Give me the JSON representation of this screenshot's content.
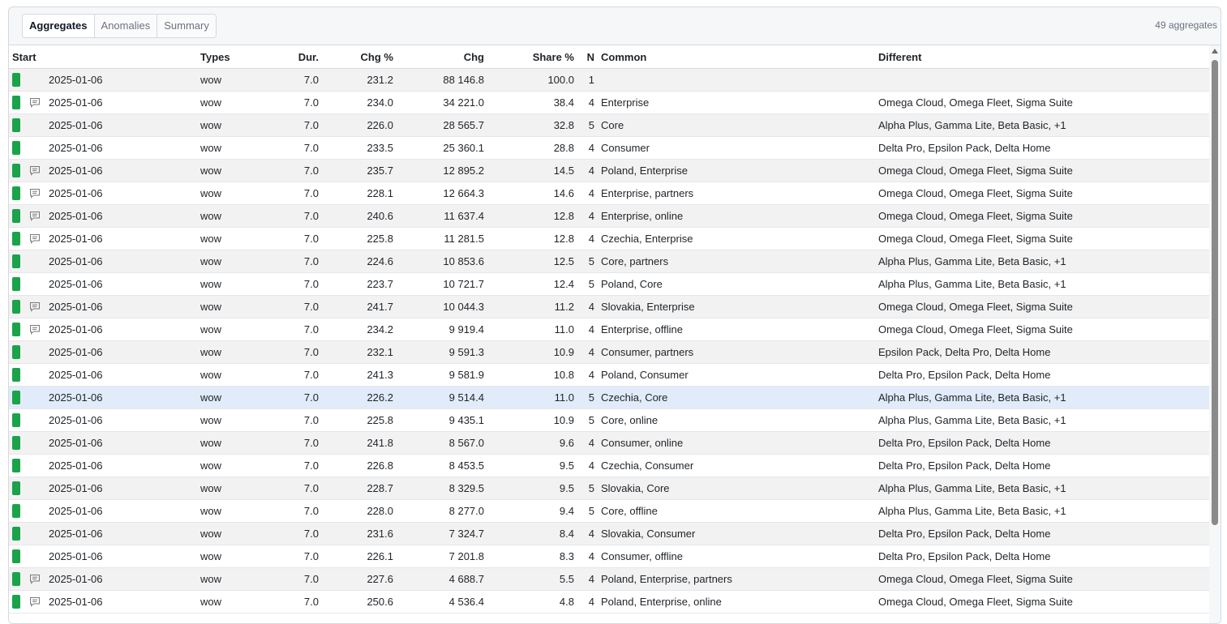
{
  "tabs": [
    {
      "label": "Aggregates",
      "active": true
    },
    {
      "label": "Anomalies",
      "active": false
    },
    {
      "label": "Summary",
      "active": false
    }
  ],
  "count_label": "49 aggregates",
  "columns": {
    "start": "Start",
    "types": "Types",
    "dur": "Dur.",
    "chg_pct": "Chg %",
    "chg": "Chg",
    "share": "Share %",
    "n": "N",
    "common": "Common",
    "different": "Different"
  },
  "colors": {
    "marker": "#1aa34a",
    "selected_row": "#e1ebf9"
  },
  "icons": {
    "comment": "comment-icon"
  },
  "rows": [
    {
      "comment": false,
      "date": "2025-01-06",
      "types": "wow",
      "dur": "7.0",
      "chg_pct": "231.2",
      "chg": "88 146.8",
      "share": "100.0",
      "n": "1",
      "common": "",
      "different": ""
    },
    {
      "comment": true,
      "date": "2025-01-06",
      "types": "wow",
      "dur": "7.0",
      "chg_pct": "234.0",
      "chg": "34 221.0",
      "share": "38.4",
      "n": "4",
      "common": "Enterprise",
      "different": "Omega Cloud, Omega Fleet, Sigma Suite"
    },
    {
      "comment": false,
      "date": "2025-01-06",
      "types": "wow",
      "dur": "7.0",
      "chg_pct": "226.0",
      "chg": "28 565.7",
      "share": "32.8",
      "n": "5",
      "common": "Core",
      "different": "Alpha Plus, Gamma Lite, Beta Basic, +1"
    },
    {
      "comment": false,
      "date": "2025-01-06",
      "types": "wow",
      "dur": "7.0",
      "chg_pct": "233.5",
      "chg": "25 360.1",
      "share": "28.8",
      "n": "4",
      "common": "Consumer",
      "different": "Delta Pro, Epsilon Pack, Delta Home"
    },
    {
      "comment": true,
      "date": "2025-01-06",
      "types": "wow",
      "dur": "7.0",
      "chg_pct": "235.7",
      "chg": "12 895.2",
      "share": "14.5",
      "n": "4",
      "common": "Poland, Enterprise",
      "different": "Omega Cloud, Omega Fleet, Sigma Suite"
    },
    {
      "comment": true,
      "date": "2025-01-06",
      "types": "wow",
      "dur": "7.0",
      "chg_pct": "228.1",
      "chg": "12 664.3",
      "share": "14.6",
      "n": "4",
      "common": "Enterprise, partners",
      "different": "Omega Cloud, Omega Fleet, Sigma Suite"
    },
    {
      "comment": true,
      "date": "2025-01-06",
      "types": "wow",
      "dur": "7.0",
      "chg_pct": "240.6",
      "chg": "11 637.4",
      "share": "12.8",
      "n": "4",
      "common": "Enterprise, online",
      "different": "Omega Cloud, Omega Fleet, Sigma Suite"
    },
    {
      "comment": true,
      "date": "2025-01-06",
      "types": "wow",
      "dur": "7.0",
      "chg_pct": "225.8",
      "chg": "11 281.5",
      "share": "12.8",
      "n": "4",
      "common": "Czechia, Enterprise",
      "different": "Omega Cloud, Omega Fleet, Sigma Suite"
    },
    {
      "comment": false,
      "date": "2025-01-06",
      "types": "wow",
      "dur": "7.0",
      "chg_pct": "224.6",
      "chg": "10 853.6",
      "share": "12.5",
      "n": "5",
      "common": "Core, partners",
      "different": "Alpha Plus, Gamma Lite, Beta Basic, +1"
    },
    {
      "comment": false,
      "date": "2025-01-06",
      "types": "wow",
      "dur": "7.0",
      "chg_pct": "223.7",
      "chg": "10 721.7",
      "share": "12.4",
      "n": "5",
      "common": "Poland, Core",
      "different": "Alpha Plus, Gamma Lite, Beta Basic, +1"
    },
    {
      "comment": true,
      "date": "2025-01-06",
      "types": "wow",
      "dur": "7.0",
      "chg_pct": "241.7",
      "chg": "10 044.3",
      "share": "11.2",
      "n": "4",
      "common": "Slovakia, Enterprise",
      "different": "Omega Cloud, Omega Fleet, Sigma Suite"
    },
    {
      "comment": true,
      "date": "2025-01-06",
      "types": "wow",
      "dur": "7.0",
      "chg_pct": "234.2",
      "chg": "9 919.4",
      "share": "11.0",
      "n": "4",
      "common": "Enterprise, offline",
      "different": "Omega Cloud, Omega Fleet, Sigma Suite"
    },
    {
      "comment": false,
      "date": "2025-01-06",
      "types": "wow",
      "dur": "7.0",
      "chg_pct": "232.1",
      "chg": "9 591.3",
      "share": "10.9",
      "n": "4",
      "common": "Consumer, partners",
      "different": "Epsilon Pack, Delta Pro, Delta Home"
    },
    {
      "comment": false,
      "date": "2025-01-06",
      "types": "wow",
      "dur": "7.0",
      "chg_pct": "241.3",
      "chg": "9 581.9",
      "share": "10.8",
      "n": "4",
      "common": "Poland, Consumer",
      "different": "Delta Pro, Epsilon Pack, Delta Home"
    },
    {
      "comment": false,
      "selected": true,
      "date": "2025-01-06",
      "types": "wow",
      "dur": "7.0",
      "chg_pct": "226.2",
      "chg": "9 514.4",
      "share": "11.0",
      "n": "5",
      "common": "Czechia, Core",
      "different": "Alpha Plus, Gamma Lite, Beta Basic, +1"
    },
    {
      "comment": false,
      "date": "2025-01-06",
      "types": "wow",
      "dur": "7.0",
      "chg_pct": "225.8",
      "chg": "9 435.1",
      "share": "10.9",
      "n": "5",
      "common": "Core, online",
      "different": "Alpha Plus, Gamma Lite, Beta Basic, +1"
    },
    {
      "comment": false,
      "date": "2025-01-06",
      "types": "wow",
      "dur": "7.0",
      "chg_pct": "241.8",
      "chg": "8 567.0",
      "share": "9.6",
      "n": "4",
      "common": "Consumer, online",
      "different": "Delta Pro, Epsilon Pack, Delta Home"
    },
    {
      "comment": false,
      "date": "2025-01-06",
      "types": "wow",
      "dur": "7.0",
      "chg_pct": "226.8",
      "chg": "8 453.5",
      "share": "9.5",
      "n": "4",
      "common": "Czechia, Consumer",
      "different": "Delta Pro, Epsilon Pack, Delta Home"
    },
    {
      "comment": false,
      "date": "2025-01-06",
      "types": "wow",
      "dur": "7.0",
      "chg_pct": "228.7",
      "chg": "8 329.5",
      "share": "9.5",
      "n": "5",
      "common": "Slovakia, Core",
      "different": "Alpha Plus, Gamma Lite, Beta Basic, +1"
    },
    {
      "comment": false,
      "date": "2025-01-06",
      "types": "wow",
      "dur": "7.0",
      "chg_pct": "228.0",
      "chg": "8 277.0",
      "share": "9.4",
      "n": "5",
      "common": "Core, offline",
      "different": "Alpha Plus, Gamma Lite, Beta Basic, +1"
    },
    {
      "comment": false,
      "date": "2025-01-06",
      "types": "wow",
      "dur": "7.0",
      "chg_pct": "231.6",
      "chg": "7 324.7",
      "share": "8.4",
      "n": "4",
      "common": "Slovakia, Consumer",
      "different": "Delta Pro, Epsilon Pack, Delta Home"
    },
    {
      "comment": false,
      "date": "2025-01-06",
      "types": "wow",
      "dur": "7.0",
      "chg_pct": "226.1",
      "chg": "7 201.8",
      "share": "8.3",
      "n": "4",
      "common": "Consumer, offline",
      "different": "Delta Pro, Epsilon Pack, Delta Home"
    },
    {
      "comment": true,
      "date": "2025-01-06",
      "types": "wow",
      "dur": "7.0",
      "chg_pct": "227.6",
      "chg": "4 688.7",
      "share": "5.5",
      "n": "4",
      "common": "Poland, Enterprise, partners",
      "different": "Omega Cloud, Omega Fleet, Sigma Suite"
    },
    {
      "comment": true,
      "date": "2025-01-06",
      "types": "wow",
      "dur": "7.0",
      "chg_pct": "250.6",
      "chg": "4 536.4",
      "share": "4.8",
      "n": "4",
      "common": "Poland, Enterprise, online",
      "different": "Omega Cloud, Omega Fleet, Sigma Suite"
    }
  ]
}
